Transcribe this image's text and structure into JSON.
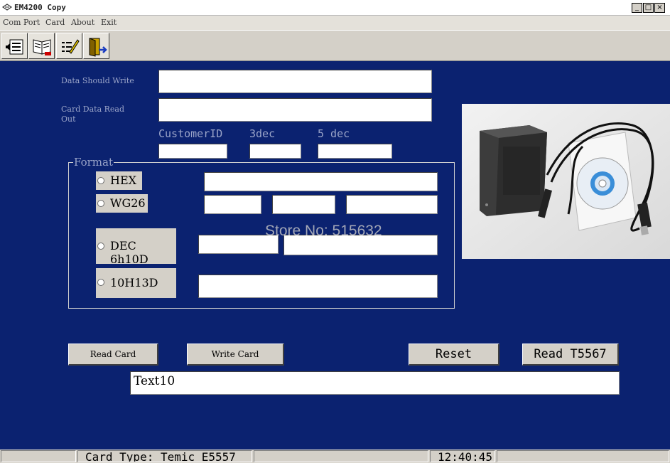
{
  "window": {
    "title": "EM4200 Copy",
    "controls": {
      "minimize": "_",
      "maximize": "□",
      "close": "×"
    }
  },
  "menu": {
    "items": [
      "Com Port",
      "Card",
      "About",
      "Exit"
    ]
  },
  "toolbar": {
    "buttons": [
      "com-port-icon",
      "card-read-icon",
      "edit-icon",
      "exit-door-icon"
    ]
  },
  "form": {
    "data_should_write_label": "Data Should Write",
    "data_should_write_value": "",
    "card_data_read_label_line1": "Card Data Read",
    "card_data_read_label_line2": "Out",
    "card_data_read_value": "",
    "customer_id_label": "CustomerID",
    "three_dec_label": "3dec",
    "five_dec_label": "5 dec",
    "customer_id_value": "",
    "three_dec_value": "",
    "five_dec_value": ""
  },
  "format": {
    "legend": "Format",
    "options": [
      {
        "label": "HEX",
        "selected": false
      },
      {
        "label": "WG26",
        "selected": false
      },
      {
        "label": "DEC 6h10D",
        "selected": false
      },
      {
        "label": "10H13D",
        "selected": false
      }
    ],
    "hex_value": "",
    "wg26_values": [
      "",
      "",
      ""
    ],
    "dec_values": [
      "",
      ""
    ],
    "h13d_value": ""
  },
  "buttons": {
    "read_card": "Read Card",
    "write_card": "Write Card",
    "reset": "Reset",
    "read_t5567": "Read T5567"
  },
  "output": {
    "text": "Text10"
  },
  "watermark": "Store No: 515632",
  "status": {
    "card_type": "Card Type: Temic E5557",
    "time": "12:40:45"
  },
  "colors": {
    "panel_background": "#0b2270",
    "label_text": "#9aa4c8",
    "chrome": "#d4d0c8"
  }
}
